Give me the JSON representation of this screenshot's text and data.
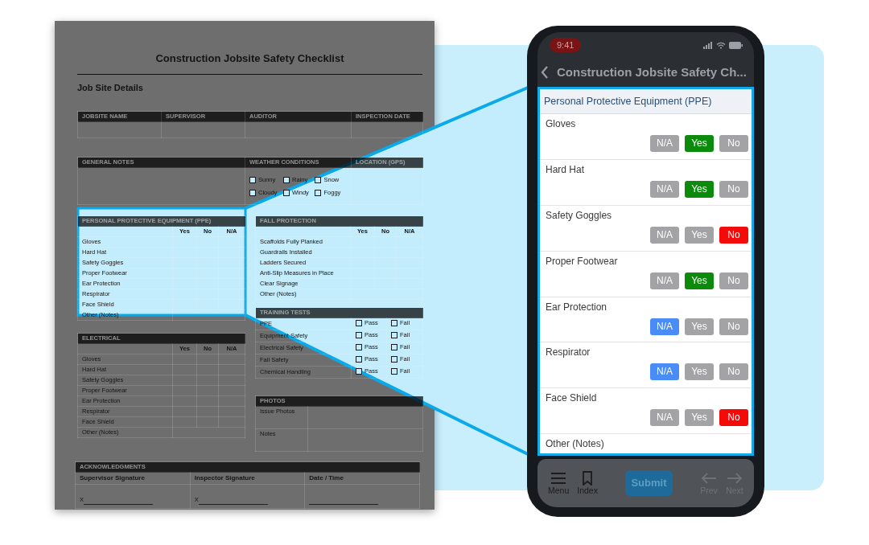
{
  "document": {
    "title": "Construction Jobsite Safety Checklist",
    "subtitle": "Job Site Details",
    "details_columns": [
      "JOBSITE NAME",
      "SUPERVISOR",
      "AUDITOR",
      "INSPECTION DATE"
    ],
    "notes_columns": [
      "GENERAL NOTES",
      "WEATHER CONDITIONS",
      "LOCATION (GPS)"
    ],
    "weather": [
      {
        "label": "Sunny",
        "checked": false
      },
      {
        "label": "Rainy",
        "checked": false
      },
      {
        "label": "Snow",
        "checked": false
      },
      {
        "label": "Cloudy",
        "checked": false
      },
      {
        "label": "Windy",
        "checked": false
      },
      {
        "label": "Foggy",
        "checked": false
      }
    ],
    "left_sections": [
      {
        "kind": "matrix",
        "title": "PERSONAL PROTECTIVE EQUIPMENT (PPE)",
        "columns": [
          "Yes",
          "No",
          "N/A"
        ],
        "rows": [
          {
            "label": "Gloves",
            "kind": "check"
          },
          {
            "label": "Hard Hat",
            "kind": "check"
          },
          {
            "label": "Safety Goggles",
            "kind": "check"
          },
          {
            "label": "Proper Footwear",
            "kind": "check"
          },
          {
            "label": "Ear Protection",
            "kind": "check"
          },
          {
            "label": "Respirator",
            "kind": "check"
          },
          {
            "label": "Face Shield",
            "kind": "check"
          },
          {
            "label": "Other (Notes)",
            "kind": "note"
          }
        ]
      },
      {
        "kind": "matrix",
        "title": "ELECTRICAL",
        "columns": [
          "Yes",
          "No",
          "N/A"
        ],
        "rows": [
          {
            "label": "Gloves",
            "kind": "check"
          },
          {
            "label": "Hard Hat",
            "kind": "check"
          },
          {
            "label": "Safety Goggles",
            "kind": "check"
          },
          {
            "label": "Proper Footwear",
            "kind": "check"
          },
          {
            "label": "Ear Protection",
            "kind": "check"
          },
          {
            "label": "Respirator",
            "kind": "check"
          },
          {
            "label": "Face Shield",
            "kind": "check"
          },
          {
            "label": "Other (Notes)",
            "kind": "note"
          }
        ]
      }
    ],
    "right_sections": [
      {
        "kind": "matrix",
        "title": "FALL PROTECTION",
        "columns": [
          "Yes",
          "No",
          "N/A"
        ],
        "rows": [
          {
            "label": "Scaffolds Fully Planked",
            "kind": "check"
          },
          {
            "label": "Guardrails Installed",
            "kind": "check"
          },
          {
            "label": "Ladders Secured",
            "kind": "check"
          },
          {
            "label": "Anti-Slip Measures in Place",
            "kind": "check"
          },
          {
            "label": "Clear Signage",
            "kind": "check"
          },
          {
            "label": "Other (Notes)",
            "kind": "note"
          }
        ]
      },
      {
        "kind": "pass_fail",
        "title": "TRAINING TESTS",
        "rows": [
          {
            "label": "PPE",
            "options": [
              {
                "label": "Pass",
                "checked": false
              },
              {
                "label": "Fail",
                "checked": false
              }
            ]
          },
          {
            "label": "Equipment Safety",
            "options": [
              {
                "label": "Pass",
                "checked": false
              },
              {
                "label": "Fail",
                "checked": false
              }
            ]
          },
          {
            "label": "Electrical Safety",
            "options": [
              {
                "label": "Pass",
                "checked": false
              },
              {
                "label": "Fail",
                "checked": false
              }
            ]
          },
          {
            "label": "Fall Safety",
            "options": [
              {
                "label": "Pass",
                "checked": false
              },
              {
                "label": "Fail",
                "checked": false
              }
            ]
          },
          {
            "label": "Chemical Handling",
            "options": [
              {
                "label": "Pass",
                "checked": false
              },
              {
                "label": "Fail",
                "checked": false
              }
            ]
          }
        ]
      },
      {
        "kind": "fields",
        "title": "PHOTOS",
        "rows": [
          {
            "label": "Issue Photos"
          },
          {
            "label": "Notes"
          }
        ]
      }
    ],
    "acknowledgments": {
      "title": "ACKNOWLEDGMENTS",
      "columns": [
        {
          "label": "Supervisor Signature",
          "prefix": "X"
        },
        {
          "label": "Inspector Signature",
          "prefix": "X"
        },
        {
          "label": "Date / Time"
        }
      ]
    }
  },
  "phone": {
    "time": "9:41",
    "nav_title": "Construction Jobsite Safety Ch...",
    "section_title": "Personal Protective Equipment (PPE)",
    "items": [
      {
        "kind": "choice",
        "label": "Gloves",
        "options": [
          {
            "label": "N/A",
            "selected": false
          },
          {
            "label": "Yes",
            "selected": true
          },
          {
            "label": "No",
            "selected": false
          }
        ]
      },
      {
        "kind": "choice",
        "label": "Hard Hat",
        "options": [
          {
            "label": "N/A",
            "selected": false
          },
          {
            "label": "Yes",
            "selected": true
          },
          {
            "label": "No",
            "selected": false
          }
        ]
      },
      {
        "kind": "choice",
        "label": "Safety Goggles",
        "options": [
          {
            "label": "N/A",
            "selected": false
          },
          {
            "label": "Yes",
            "selected": false
          },
          {
            "label": "No",
            "selected": true
          }
        ]
      },
      {
        "kind": "choice",
        "label": "Proper Footwear",
        "options": [
          {
            "label": "N/A",
            "selected": false
          },
          {
            "label": "Yes",
            "selected": true
          },
          {
            "label": "No",
            "selected": false
          }
        ]
      },
      {
        "kind": "choice",
        "label": "Ear Protection",
        "options": [
          {
            "label": "N/A",
            "selected": true
          },
          {
            "label": "Yes",
            "selected": false
          },
          {
            "label": "No",
            "selected": false
          }
        ]
      },
      {
        "kind": "choice",
        "label": "Respirator",
        "options": [
          {
            "label": "N/A",
            "selected": true
          },
          {
            "label": "Yes",
            "selected": false
          },
          {
            "label": "No",
            "selected": false
          }
        ]
      },
      {
        "kind": "choice",
        "label": "Face Shield",
        "options": [
          {
            "label": "N/A",
            "selected": false
          },
          {
            "label": "Yes",
            "selected": false
          },
          {
            "label": "No",
            "selected": true
          }
        ]
      },
      {
        "kind": "notes",
        "label": "Other (Notes)"
      }
    ],
    "toolbar": {
      "left": [
        {
          "kind": "menu",
          "label": "Menu"
        },
        {
          "kind": "bookmark",
          "label": "Index"
        }
      ],
      "submit": "Submit",
      "right": [
        {
          "kind": "back",
          "label": "Prev",
          "disabled": true
        },
        {
          "kind": "forward",
          "label": "Next",
          "disabled": true
        }
      ]
    }
  }
}
